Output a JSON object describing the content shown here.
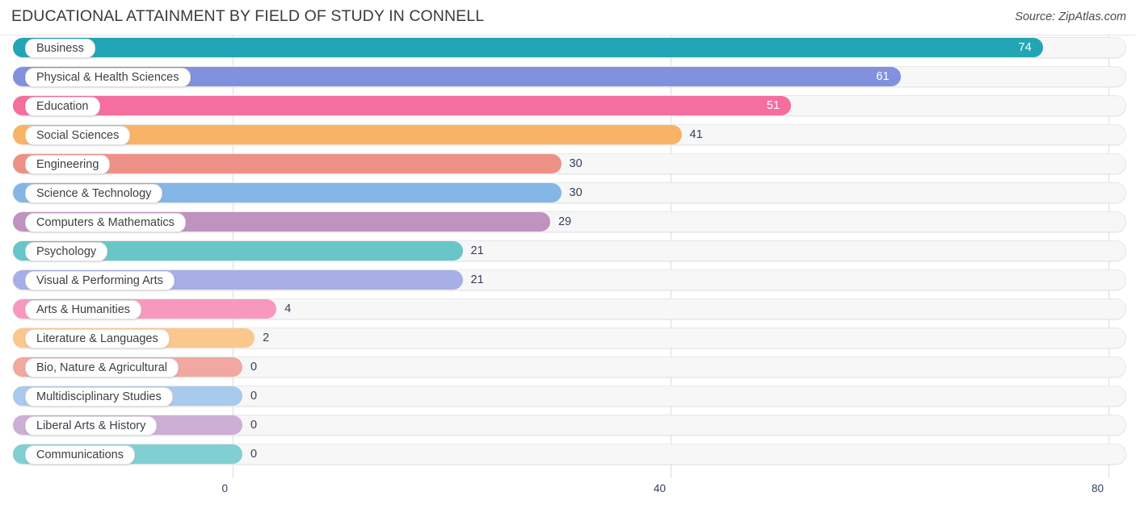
{
  "header": {
    "title": "EDUCATIONAL ATTAINMENT BY FIELD OF STUDY IN CONNELL",
    "source": "Source: ZipAtlas.com"
  },
  "chart_data": {
    "type": "bar",
    "orientation": "horizontal",
    "title": "EDUCATIONAL ATTAINMENT BY FIELD OF STUDY IN CONNELL",
    "xlabel": "",
    "ylabel": "",
    "xlim": [
      0,
      80
    ],
    "xticks": [
      0,
      40,
      80
    ],
    "xtick_labels": [
      "0",
      "40",
      "80"
    ],
    "grid": true,
    "legend": false,
    "categories": [
      "Business",
      "Physical & Health Sciences",
      "Education",
      "Social Sciences",
      "Engineering",
      "Science & Technology",
      "Computers & Mathematics",
      "Psychology",
      "Visual & Performing Arts",
      "Arts & Humanities",
      "Literature & Languages",
      "Bio, Nature & Agricultural",
      "Multidisciplinary Studies",
      "Liberal Arts & History",
      "Communications"
    ],
    "values": [
      74,
      61,
      51,
      41,
      30,
      30,
      29,
      21,
      21,
      4,
      2,
      0,
      0,
      0,
      0
    ],
    "value_labels": [
      "74",
      "61",
      "51",
      "41",
      "30",
      "30",
      "29",
      "21",
      "21",
      "4",
      "2",
      "0",
      "0",
      "0",
      "0"
    ],
    "colors": [
      "#24a5b5",
      "#8290e0",
      "#f56e9d",
      "#f9b367",
      "#ed9186",
      "#85b7e6",
      "#bf93c0",
      "#68c6c9",
      "#a8aee6",
      "#f799bf",
      "#fbc78d",
      "#f0a8a0",
      "#a8caec",
      "#cdaed4",
      "#7fcfd3"
    ]
  }
}
